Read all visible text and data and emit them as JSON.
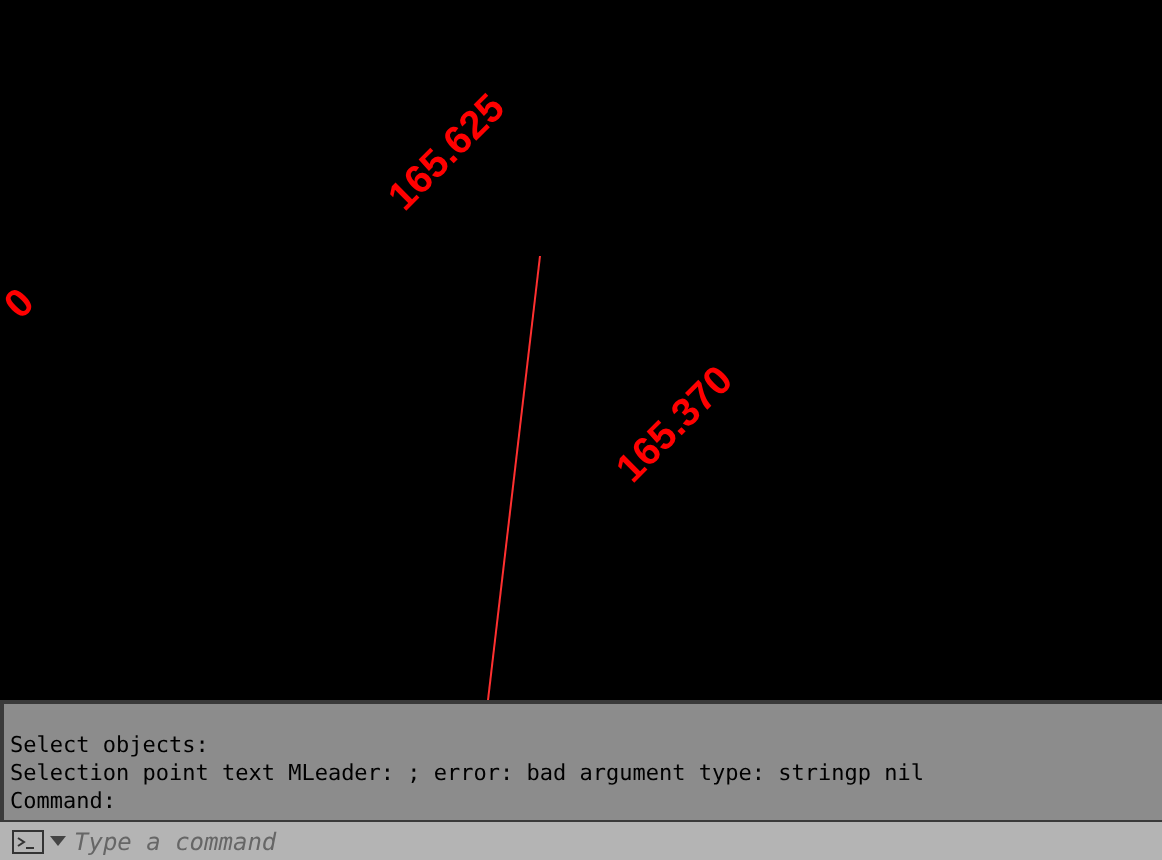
{
  "drawing": {
    "labels": [
      {
        "text": "0"
      },
      {
        "text": "165.625"
      },
      {
        "text": "165.370"
      }
    ]
  },
  "command_history": [
    "Select objects:",
    "Selection point text MLeader: ; error: bad argument type: stringp nil",
    "Command:"
  ],
  "command_input": {
    "placeholder": "Type a command"
  }
}
